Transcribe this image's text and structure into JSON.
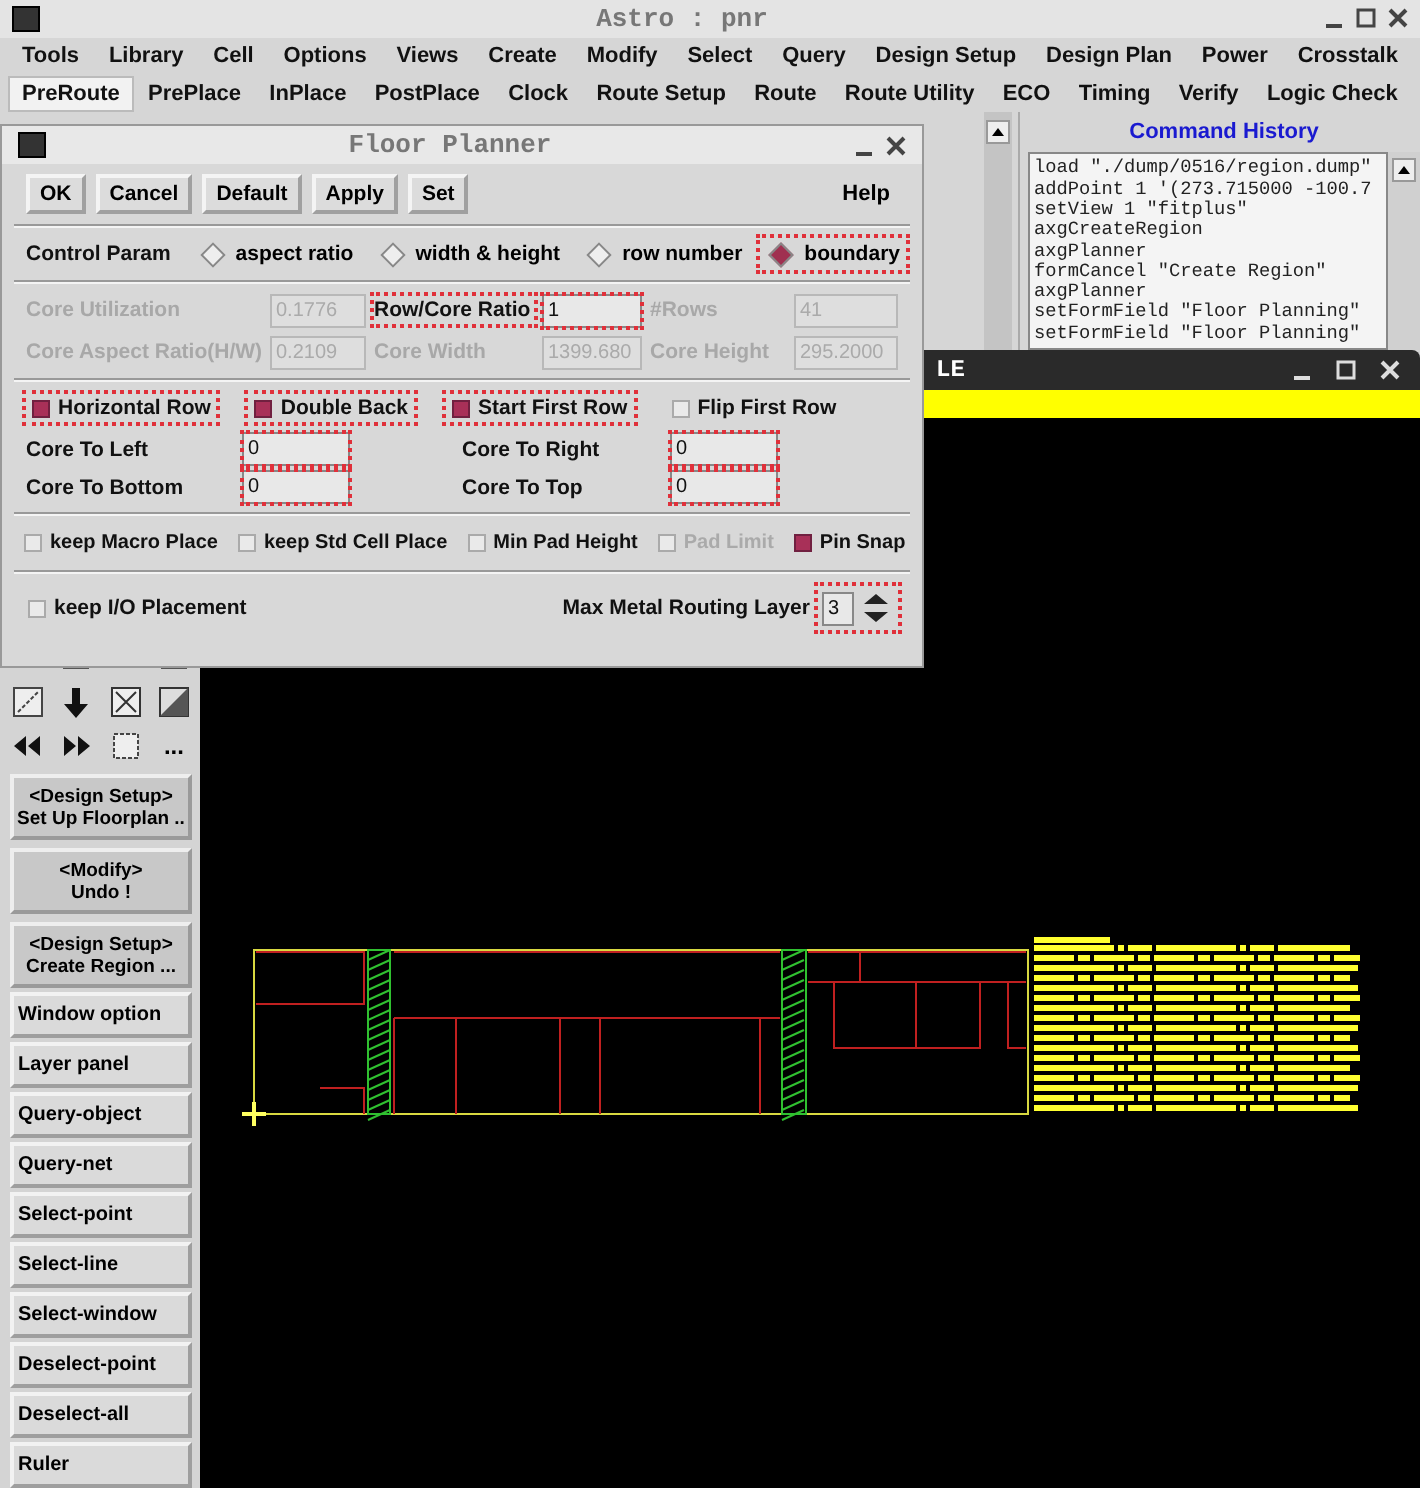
{
  "window": {
    "title": "Astro : pnr"
  },
  "menu_rows": [
    [
      {
        "label": "Tools",
        "selected": false
      },
      {
        "label": "Library",
        "selected": false
      },
      {
        "label": "Cell",
        "selected": false
      },
      {
        "label": "Options",
        "selected": false
      },
      {
        "label": "Views",
        "selected": false
      },
      {
        "label": "Create",
        "selected": false
      },
      {
        "label": "Modify",
        "selected": false
      },
      {
        "label": "Select",
        "selected": false
      },
      {
        "label": "Query",
        "selected": false
      },
      {
        "label": "Design Setup",
        "selected": false
      },
      {
        "label": "Design Plan",
        "selected": false
      },
      {
        "label": "Power",
        "selected": false
      },
      {
        "label": "Crosstalk",
        "selected": false
      }
    ],
    [
      {
        "label": "PreRoute",
        "selected": true
      },
      {
        "label": "PrePlace",
        "selected": false
      },
      {
        "label": "InPlace",
        "selected": false
      },
      {
        "label": "PostPlace",
        "selected": false
      },
      {
        "label": "Clock",
        "selected": false
      },
      {
        "label": "Route Setup",
        "selected": false
      },
      {
        "label": "Route",
        "selected": false
      },
      {
        "label": "Route Utility",
        "selected": false
      },
      {
        "label": "ECO",
        "selected": false
      },
      {
        "label": "Timing",
        "selected": false
      },
      {
        "label": "Verify",
        "selected": false
      },
      {
        "label": "Logic Check",
        "selected": false
      }
    ]
  ],
  "command_history": {
    "title": "Command History",
    "lines": [
      "load \"./dump/0516/region.dump\"",
      "addPoint 1 '(273.715000 -100.7",
      "setView 1  \"fitplus\"",
      "axgCreateRegion",
      "axgPlanner",
      "formCancel \"Create Region\"",
      "axgPlanner",
      "setFormField \"Floor Planning\"",
      "setFormField \"Floor Planning\""
    ]
  },
  "layout_window": {
    "title": "LE",
    "more_button": "...",
    "command_buttons": [
      {
        "lines": [
          "<Design Setup>",
          "Set Up Floorplan .."
        ]
      },
      {
        "lines": [
          "<Modify>",
          "Undo !"
        ]
      },
      {
        "lines": [
          "<Design Setup>",
          "Create Region ..."
        ]
      }
    ],
    "buttons": [
      "Window option",
      "Layer panel",
      "Query-object",
      "Query-net",
      "Select-point",
      "Select-line",
      "Select-window",
      "Deselect-point",
      "Deselect-all",
      "Ruler"
    ]
  },
  "floor_planner": {
    "title": "Floor Planner",
    "buttons": [
      "OK",
      "Cancel",
      "Default",
      "Apply",
      "Set"
    ],
    "help": "Help",
    "control_param": {
      "label": "Control Param",
      "options": [
        {
          "label": "aspect ratio",
          "selected": false,
          "highlighted": false
        },
        {
          "label": "width & height",
          "selected": false,
          "highlighted": false
        },
        {
          "label": "row number",
          "selected": false,
          "highlighted": false
        },
        {
          "label": "boundary",
          "selected": true,
          "highlighted": true
        }
      ]
    },
    "fields": [
      {
        "label": "Core Utilization",
        "value": "0.1776",
        "disabled": true,
        "highlighted": false
      },
      {
        "label": "Row/Core Ratio",
        "value": "1",
        "disabled": false,
        "highlighted": true
      },
      {
        "label": "#Rows",
        "value": "41",
        "disabled": true,
        "highlighted": false
      },
      {
        "label": "Core Aspect Ratio(H/W)",
        "value": "0.2109",
        "disabled": true,
        "highlighted": false
      },
      {
        "label": "Core Width",
        "value": "1399.680",
        "disabled": true,
        "highlighted": false
      },
      {
        "label": "Core Height",
        "value": "295.2000",
        "disabled": true,
        "highlighted": false
      }
    ],
    "row_options": [
      {
        "label": "Horizontal Row",
        "checked": true,
        "highlighted": true
      },
      {
        "label": "Double Back",
        "checked": true,
        "highlighted": true
      },
      {
        "label": "Start First Row",
        "checked": true,
        "highlighted": true
      },
      {
        "label": "Flip First Row",
        "checked": false,
        "highlighted": false
      }
    ],
    "core_offsets": [
      {
        "label": "Core To Left",
        "value": "0",
        "highlighted": true
      },
      {
        "label": "Core To Right",
        "value": "0",
        "highlighted": true
      },
      {
        "label": "Core To Bottom",
        "value": "0",
        "highlighted": true
      },
      {
        "label": "Core To Top",
        "value": "0",
        "highlighted": true
      }
    ],
    "place_options": [
      {
        "label": "keep Macro Place",
        "checked": false,
        "disabled": false
      },
      {
        "label": "keep Std Cell Place",
        "checked": false,
        "disabled": false
      },
      {
        "label": "Min Pad Height",
        "checked": false,
        "disabled": false
      },
      {
        "label": "Pad Limit",
        "checked": false,
        "disabled": true
      },
      {
        "label": "Pin Snap",
        "checked": true,
        "disabled": false
      }
    ],
    "io_option": {
      "label": "keep I/O Placement",
      "checked": false
    },
    "max_layer": {
      "label": "Max Metal Routing Layer",
      "value": "3",
      "highlighted": true
    }
  }
}
